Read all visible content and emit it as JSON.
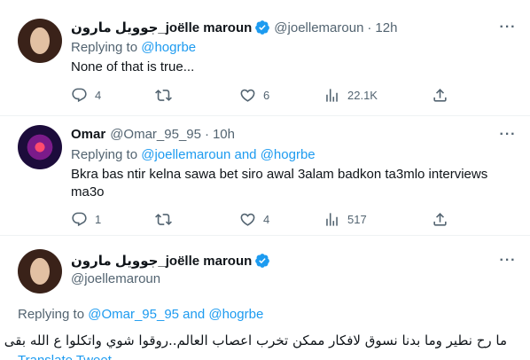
{
  "tweets": [
    {
      "name": "جوويل مارون_joëlle maroun",
      "handle": "@joellemaroun",
      "time": "12h",
      "replying_prefix": "Replying to",
      "replying_to": "@hogrbe",
      "text": "None of that is true...",
      "stats": {
        "replies": "4",
        "retweets": "",
        "likes": "6",
        "views": "22.1K"
      }
    },
    {
      "name": "Omar",
      "handle": "@Omar_95_95",
      "time": "10h",
      "replying_prefix": "Replying to",
      "replying_to": "@joellemaroun and @hogrbe",
      "text_line1": "Bkra bas ntir kelna sawa bet siro awal 3alam badkon ta3mlo interviews",
      "text_line2": "ma3o",
      "stats": {
        "replies": "1",
        "retweets": "",
        "likes": "4",
        "views": "517"
      }
    },
    {
      "name": "جوويل مارون_joëlle maroun",
      "handle": "@joellemaroun",
      "replying_prefix": "Replying to",
      "replying_to": "@Omar_95_95 and @hogrbe",
      "text": "ما رح نطير وما بدنا نسوق لافكار ممكن تخرب اعصاب العالم..روقوا شوي واتكلوا ع الله بقى",
      "translate_label": "Translate Tweet"
    }
  ],
  "dot": "·",
  "colors": {
    "accent": "#1d9bf0",
    "muted": "#536471",
    "text": "#0f1419"
  },
  "icons": [
    "more-icon",
    "verified-badge-icon",
    "reply-icon",
    "retweet-icon",
    "like-icon",
    "views-icon",
    "share-icon"
  ]
}
